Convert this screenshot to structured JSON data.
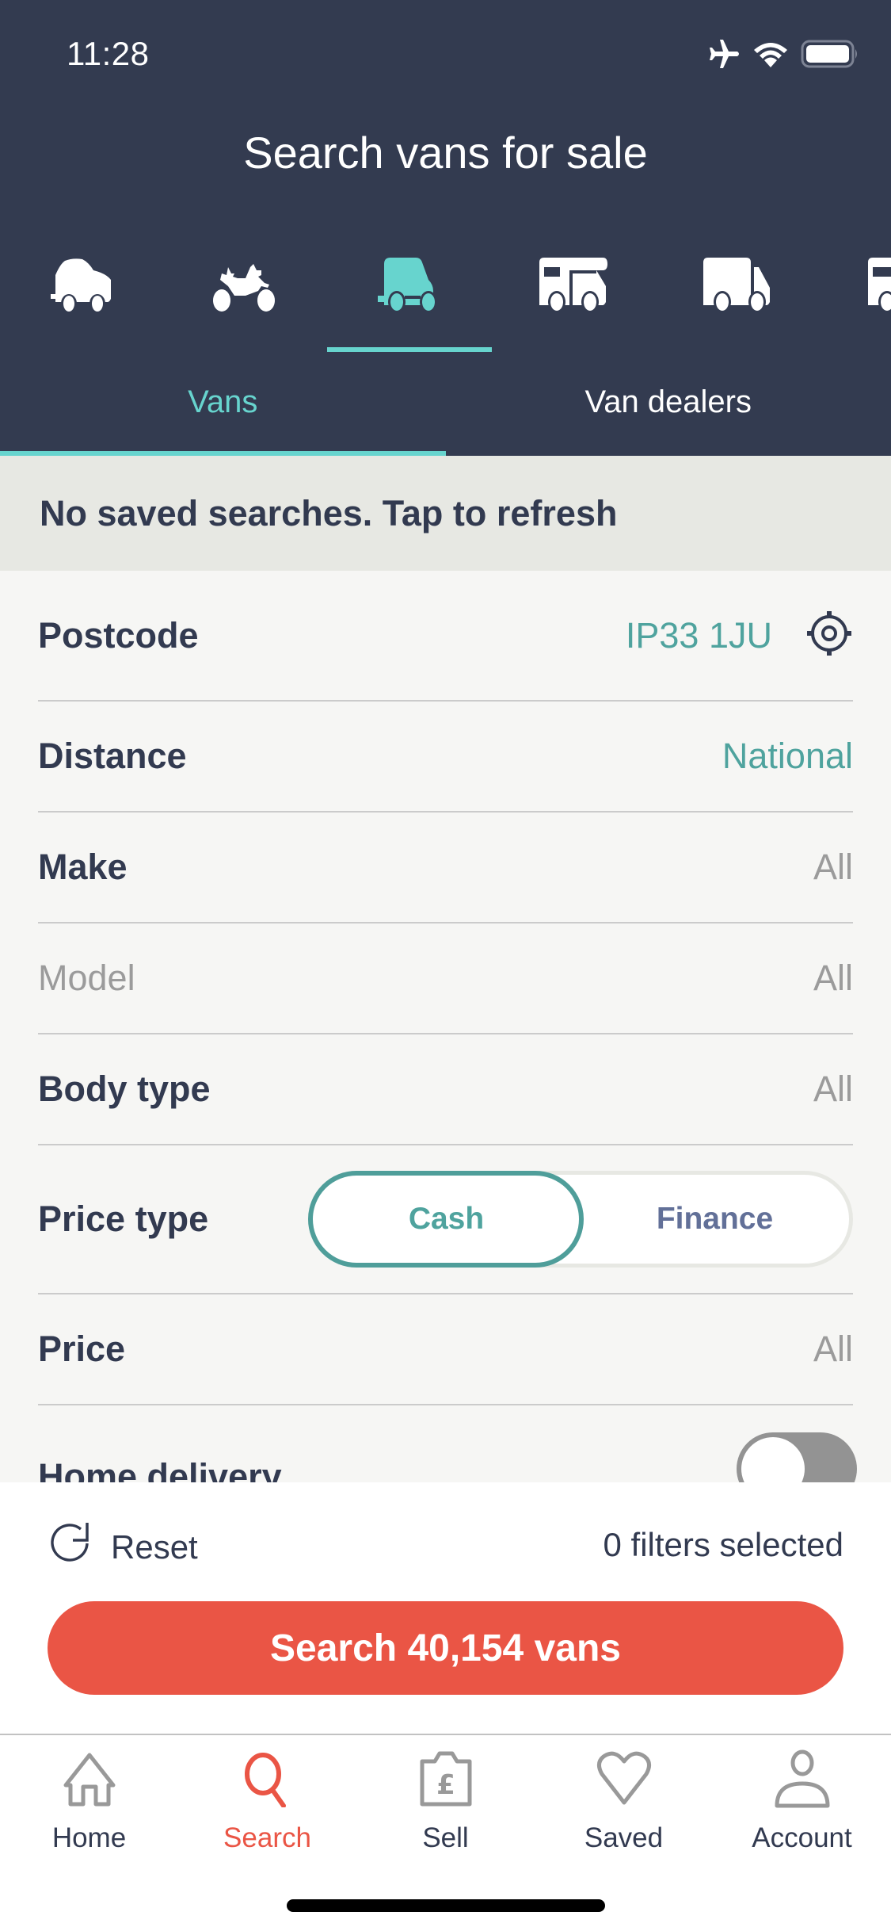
{
  "status_bar": {
    "time": "11:28",
    "icons": [
      "airplane-icon",
      "wifi-icon",
      "battery-icon"
    ]
  },
  "header": {
    "title": "Search vans for sale"
  },
  "vehicle_types": [
    {
      "name": "car",
      "icon": "car-icon",
      "selected": false
    },
    {
      "name": "motorbike",
      "icon": "motorbike-icon",
      "selected": false
    },
    {
      "name": "van",
      "icon": "van-icon",
      "selected": true
    },
    {
      "name": "motorhome",
      "icon": "motorhome-icon",
      "selected": false
    },
    {
      "name": "truck",
      "icon": "truck-icon",
      "selected": false
    },
    {
      "name": "caravan",
      "icon": "caravan-icon",
      "selected": false
    }
  ],
  "tabs": [
    {
      "label": "Vans",
      "active": true
    },
    {
      "label": "Van dealers",
      "active": false
    }
  ],
  "banner": {
    "text": "No saved searches. Tap to refresh"
  },
  "filters": {
    "postcode": {
      "label": "Postcode",
      "value": "IP33 1JU",
      "icon": "location-target-icon"
    },
    "distance": {
      "label": "Distance",
      "value": "National"
    },
    "make": {
      "label": "Make",
      "value": "All"
    },
    "model": {
      "label": "Model",
      "value": "All",
      "disabled": true
    },
    "body_type": {
      "label": "Body type",
      "value": "All"
    },
    "price_type": {
      "label": "Price type",
      "options": [
        "Cash",
        "Finance"
      ],
      "selected": "Cash"
    },
    "price": {
      "label": "Price",
      "value": "All"
    },
    "home_delivery": {
      "label": "Home delivery",
      "enabled": false
    }
  },
  "footer": {
    "reset_label": "Reset",
    "filters_selected": "0 filters selected",
    "search_button": "Search 40,154 vans"
  },
  "tabbar": {
    "items": [
      {
        "label": "Home",
        "icon": "home-icon",
        "active": false
      },
      {
        "label": "Search",
        "icon": "search-icon",
        "active": true
      },
      {
        "label": "Sell",
        "icon": "sell-pound-icon",
        "active": false
      },
      {
        "label": "Saved",
        "icon": "heart-icon",
        "active": false
      },
      {
        "label": "Account",
        "icon": "person-icon",
        "active": false
      }
    ]
  },
  "colors": {
    "header_bg": "#333b50",
    "accent_teal": "#67d4ce",
    "value_teal": "#4fa39e",
    "primary_red": "#ea5545",
    "text_dark": "#323a50",
    "text_muted": "#9b9b9b",
    "banner_bg": "#e7e8e3",
    "page_bg": "#f6f6f4"
  }
}
